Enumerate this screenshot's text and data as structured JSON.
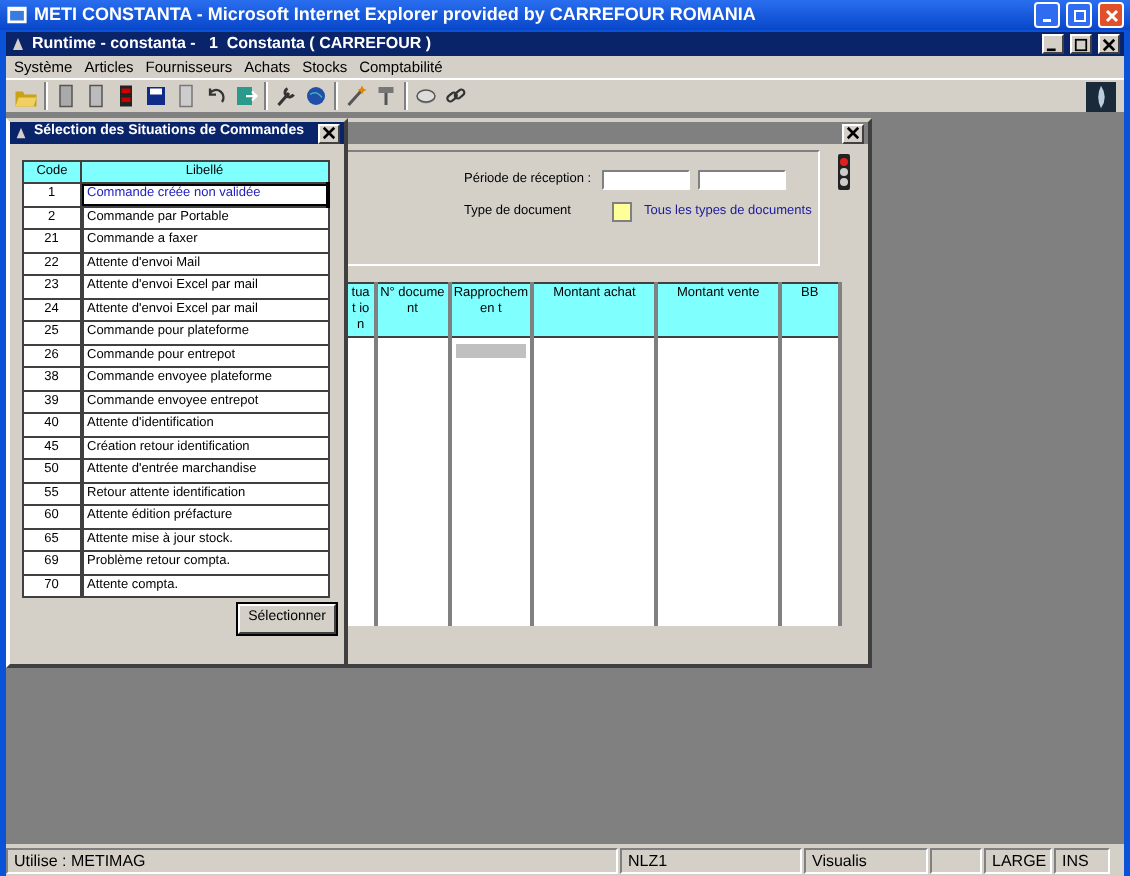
{
  "browser_window": {
    "title": "METI CONSTANTA - Microsoft Internet Explorer provided by CARREFOUR ROMANIA"
  },
  "app_window": {
    "title": "Runtime - constanta -   1  Constanta ( CARREFOUR )"
  },
  "menu": [
    "Système",
    "Articles",
    "Fournisseurs",
    "Achats",
    "Stocks",
    "Comptabilité"
  ],
  "document_window": {
    "reception_period_label": "Période de réception :",
    "document_type_label": "Type de document",
    "document_type_option": "Tous les types de documents",
    "document_type_checked": false,
    "columns": [
      "tuat ion",
      "N° document",
      "Rapprochemen t",
      "Montant achat",
      "Montant vente",
      "BB"
    ]
  },
  "dialog": {
    "title": "Sélection des Situations de Commandes",
    "columns": [
      "Code",
      "Libellé"
    ],
    "rows": [
      {
        "code": "1",
        "label": "Commande créée non validée",
        "selected": true
      },
      {
        "code": "2",
        "label": "Commande par Portable",
        "selected": false
      },
      {
        "code": "21",
        "label": "Commande a faxer",
        "selected": false
      },
      {
        "code": "22",
        "label": "Attente d'envoi Mail",
        "selected": false
      },
      {
        "code": "23",
        "label": "Attente d'envoi Excel par mail",
        "selected": false
      },
      {
        "code": "24",
        "label": "Attente d'envoi Excel par mail",
        "selected": false
      },
      {
        "code": "25",
        "label": "Commande pour plateforme",
        "selected": false
      },
      {
        "code": "26",
        "label": "Commande pour entrepot",
        "selected": false
      },
      {
        "code": "38",
        "label": "Commande envoyee plateforme",
        "selected": false
      },
      {
        "code": "39",
        "label": "Commande envoyee entrepot",
        "selected": false
      },
      {
        "code": "40",
        "label": "Attente d'identification",
        "selected": false
      },
      {
        "code": "45",
        "label": "Création retour identification",
        "selected": false
      },
      {
        "code": "50",
        "label": "Attente d'entrée marchandise",
        "selected": false
      },
      {
        "code": "55",
        "label": "Retour attente identification",
        "selected": false
      },
      {
        "code": "60",
        "label": "Attente édition préfacture",
        "selected": false
      },
      {
        "code": "65",
        "label": "Attente mise à jour stock.",
        "selected": false
      },
      {
        "code": "69",
        "label": "Problème retour compta.",
        "selected": false
      },
      {
        "code": "70",
        "label": "Attente compta.",
        "selected": false
      }
    ],
    "button": "Sélectionner"
  },
  "status_bar": [
    {
      "kind": "text",
      "text": "Utilise : METIMAG"
    },
    {
      "kind": "text",
      "text": "NLZ1"
    },
    {
      "kind": "text",
      "text": "Visualis"
    },
    {
      "kind": "blank"
    },
    {
      "kind": "text",
      "text": "LARGE"
    },
    {
      "kind": "text",
      "text": "INS"
    }
  ]
}
